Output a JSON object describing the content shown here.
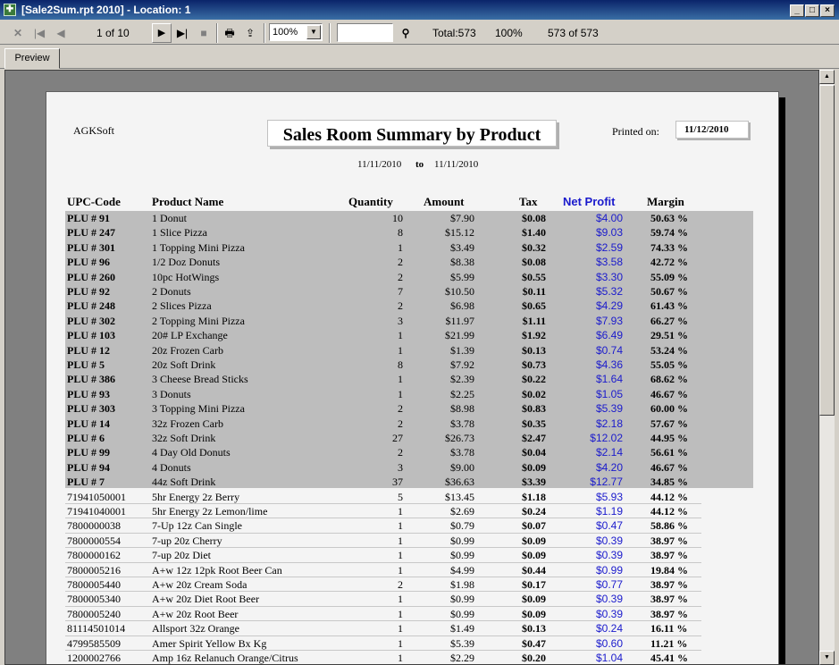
{
  "window": {
    "title": "[Sale2Sum.rpt 2010] - Location: 1"
  },
  "toolbar": {
    "page_indicator": "1 of 10",
    "zoom_value": "100%",
    "total": "Total:573",
    "percent": "100%",
    "record_count": "573 of 573",
    "search_value": ""
  },
  "tabs": {
    "preview": "Preview"
  },
  "report": {
    "company": "AGKSoft",
    "title": "Sales Room Summary by Product",
    "printed_label": "Printed on:",
    "printed_date": "11/12/2010",
    "date_from": "11/11/2010",
    "date_to_word": "to",
    "date_to": "11/11/2010",
    "headers": {
      "upc": "UPC-Code",
      "name": "Product Name",
      "qty": "Quantity",
      "amount": "Amount",
      "tax": "Tax",
      "net": "Net Profit",
      "margin": "Margin"
    },
    "rows": [
      {
        "upc": "PLU # 91",
        "name": "1 Donut",
        "qty": "10",
        "amount": "$7.90",
        "tax": "$0.08",
        "net": "$4.00",
        "margin": "50.63 %"
      },
      {
        "upc": "PLU # 247",
        "name": "1 Slice Pizza",
        "qty": "8",
        "amount": "$15.12",
        "tax": "$1.40",
        "net": "$9.03",
        "margin": "59.74 %"
      },
      {
        "upc": "PLU # 301",
        "name": "1 Topping Mini Pizza",
        "qty": "1",
        "amount": "$3.49",
        "tax": "$0.32",
        "net": "$2.59",
        "margin": "74.33 %"
      },
      {
        "upc": "PLU # 96",
        "name": "1/2 Doz Donuts",
        "qty": "2",
        "amount": "$8.38",
        "tax": "$0.08",
        "net": "$3.58",
        "margin": "42.72 %"
      },
      {
        "upc": "PLU # 260",
        "name": "10pc HotWings",
        "qty": "2",
        "amount": "$5.99",
        "tax": "$0.55",
        "net": "$3.30",
        "margin": "55.09 %"
      },
      {
        "upc": "PLU # 92",
        "name": "2 Donuts",
        "qty": "7",
        "amount": "$10.50",
        "tax": "$0.11",
        "net": "$5.32",
        "margin": "50.67 %"
      },
      {
        "upc": "PLU # 248",
        "name": "2 Slices Pizza",
        "qty": "2",
        "amount": "$6.98",
        "tax": "$0.65",
        "net": "$4.29",
        "margin": "61.43 %"
      },
      {
        "upc": "PLU # 302",
        "name": "2 Topping Mini Pizza",
        "qty": "3",
        "amount": "$11.97",
        "tax": "$1.11",
        "net": "$7.93",
        "margin": "66.27 %"
      },
      {
        "upc": "PLU # 103",
        "name": "20# LP Exchange",
        "qty": "1",
        "amount": "$21.99",
        "tax": "$1.92",
        "net": "$6.49",
        "margin": "29.51 %"
      },
      {
        "upc": "PLU # 12",
        "name": "20z Frozen Carb",
        "qty": "1",
        "amount": "$1.39",
        "tax": "$0.13",
        "net": "$0.74",
        "margin": "53.24 %"
      },
      {
        "upc": "PLU # 5",
        "name": "20z Soft Drink",
        "qty": "8",
        "amount": "$7.92",
        "tax": "$0.73",
        "net": "$4.36",
        "margin": "55.05 %"
      },
      {
        "upc": "PLU # 386",
        "name": "3 Cheese Bread Sticks",
        "qty": "1",
        "amount": "$2.39",
        "tax": "$0.22",
        "net": "$1.64",
        "margin": "68.62 %"
      },
      {
        "upc": "PLU # 93",
        "name": "3 Donuts",
        "qty": "1",
        "amount": "$2.25",
        "tax": "$0.02",
        "net": "$1.05",
        "margin": "46.67 %"
      },
      {
        "upc": "PLU # 303",
        "name": "3 Topping Mini Pizza",
        "qty": "2",
        "amount": "$8.98",
        "tax": "$0.83",
        "net": "$5.39",
        "margin": "60.00 %"
      },
      {
        "upc": "PLU # 14",
        "name": "32z Frozen Carb",
        "qty": "2",
        "amount": "$3.78",
        "tax": "$0.35",
        "net": "$2.18",
        "margin": "57.67 %"
      },
      {
        "upc": "PLU # 6",
        "name": "32z Soft Drink",
        "qty": "27",
        "amount": "$26.73",
        "tax": "$2.47",
        "net": "$12.02",
        "margin": "44.95 %"
      },
      {
        "upc": "PLU # 99",
        "name": "4 Day Old Donuts",
        "qty": "2",
        "amount": "$3.78",
        "tax": "$0.04",
        "net": "$2.14",
        "margin": "56.61 %"
      },
      {
        "upc": "PLU # 94",
        "name": "4 Donuts",
        "qty": "3",
        "amount": "$9.00",
        "tax": "$0.09",
        "net": "$4.20",
        "margin": "46.67 %"
      },
      {
        "upc": "PLU # 7",
        "name": "44z Soft Drink",
        "qty": "37",
        "amount": "$36.63",
        "tax": "$3.39",
        "net": "$12.77",
        "margin": "34.85 %"
      },
      {
        "upc": "71941050001",
        "name": "5hr Energy 2z Berry",
        "qty": "5",
        "amount": "$13.45",
        "tax": "$1.18",
        "net": "$5.93",
        "margin": "44.12 %"
      },
      {
        "upc": "71941040001",
        "name": "5hr Energy 2z Lemon/lime",
        "qty": "1",
        "amount": "$2.69",
        "tax": "$0.24",
        "net": "$1.19",
        "margin": "44.12 %"
      },
      {
        "upc": "7800000038",
        "name": "7-Up 12z Can Single",
        "qty": "1",
        "amount": "$0.79",
        "tax": "$0.07",
        "net": "$0.47",
        "margin": "58.86 %"
      },
      {
        "upc": "7800000554",
        "name": "7-up 20z Cherry",
        "qty": "1",
        "amount": "$0.99",
        "tax": "$0.09",
        "net": "$0.39",
        "margin": "38.97 %"
      },
      {
        "upc": "7800000162",
        "name": "7-up 20z Diet",
        "qty": "1",
        "amount": "$0.99",
        "tax": "$0.09",
        "net": "$0.39",
        "margin": "38.97 %"
      },
      {
        "upc": "7800005216",
        "name": "A+w 12z 12pk Root Beer Can",
        "qty": "1",
        "amount": "$4.99",
        "tax": "$0.44",
        "net": "$0.99",
        "margin": "19.84 %"
      },
      {
        "upc": "7800005440",
        "name": "A+w 20z Cream Soda",
        "qty": "2",
        "amount": "$1.98",
        "tax": "$0.17",
        "net": "$0.77",
        "margin": "38.97 %"
      },
      {
        "upc": "7800005340",
        "name": "A+w 20z Diet Root Beer",
        "qty": "1",
        "amount": "$0.99",
        "tax": "$0.09",
        "net": "$0.39",
        "margin": "38.97 %"
      },
      {
        "upc": "7800005240",
        "name": "A+w 20z Root Beer",
        "qty": "1",
        "amount": "$0.99",
        "tax": "$0.09",
        "net": "$0.39",
        "margin": "38.97 %"
      },
      {
        "upc": "81114501014",
        "name": "Allsport 32z Orange",
        "qty": "1",
        "amount": "$1.49",
        "tax": "$0.13",
        "net": "$0.24",
        "margin": "16.11 %"
      },
      {
        "upc": "4799585509",
        "name": "Amer Spirit Yellow Bx Kg",
        "qty": "1",
        "amount": "$5.39",
        "tax": "$0.47",
        "net": "$0.60",
        "margin": "11.21 %"
      },
      {
        "upc": "1200002766",
        "name": "Amp 16z Relanuch Orange/Citrus",
        "qty": "1",
        "amount": "$2.29",
        "tax": "$0.20",
        "net": "$1.04",
        "margin": "45.41 %"
      }
    ]
  }
}
